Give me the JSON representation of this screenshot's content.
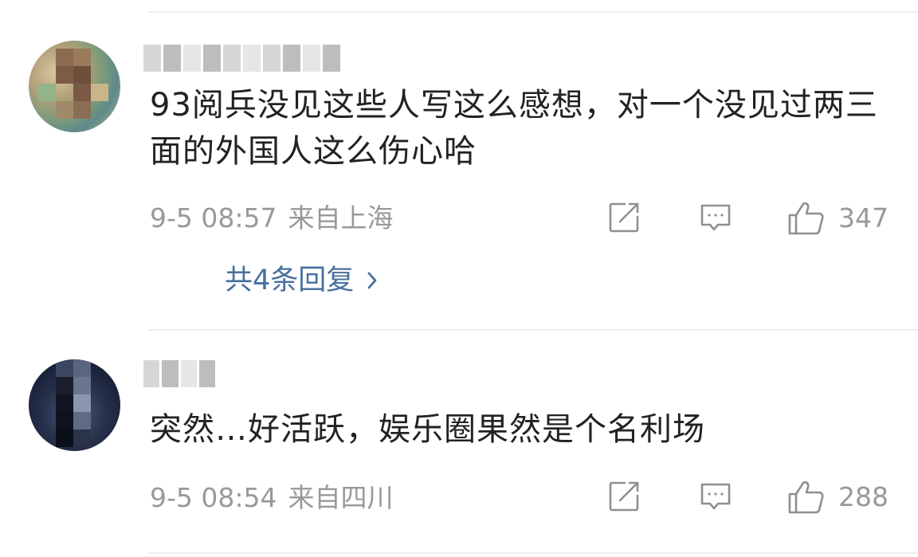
{
  "comments": [
    {
      "text": "93阅兵没见这些人写这么感想，对一个没见过两三面的外国人这么伤心哈",
      "date": "9-5 08:57",
      "location": "来自上海",
      "like_count": "347",
      "replies_label": "共4条回复"
    },
    {
      "text": "突然…好活跃，娱乐圈果然是个名利场",
      "date": "9-5 08:54",
      "location": "来自四川",
      "like_count": "288"
    }
  ],
  "icons": {
    "share": "share-icon",
    "reply": "comment-icon",
    "like": "thumbs-up-icon",
    "replies_arrow": "chevron-right-icon"
  },
  "colors": {
    "text": "#222222",
    "meta": "#999999",
    "link": "#46709e",
    "divider": "#ededed"
  }
}
